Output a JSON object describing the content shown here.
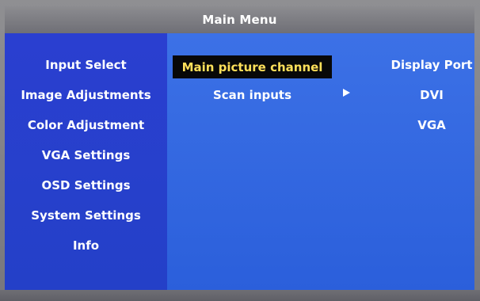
{
  "title": "Main Menu",
  "left_menu": {
    "items": [
      {
        "label": "Input Select"
      },
      {
        "label": "Image Adjustments"
      },
      {
        "label": "Color Adjustment"
      },
      {
        "label": "VGA Settings"
      },
      {
        "label": "OSD Settings"
      },
      {
        "label": "System Settings"
      },
      {
        "label": "Info"
      }
    ]
  },
  "submenu": {
    "selected": "Main picture channel",
    "items": [
      {
        "label": "Scan inputs"
      }
    ],
    "arrow_icon": "right-triangle-icon"
  },
  "options": {
    "items": [
      {
        "label": "Display Port"
      },
      {
        "label": "DVI"
      },
      {
        "label": "VGA"
      }
    ]
  },
  "colors": {
    "left_pane": "#2a3fd0",
    "right_pane": "#3c71e6",
    "selected_bg": "#080808",
    "selected_text": "#ffe05a",
    "title_bar": "#7a7a80"
  }
}
